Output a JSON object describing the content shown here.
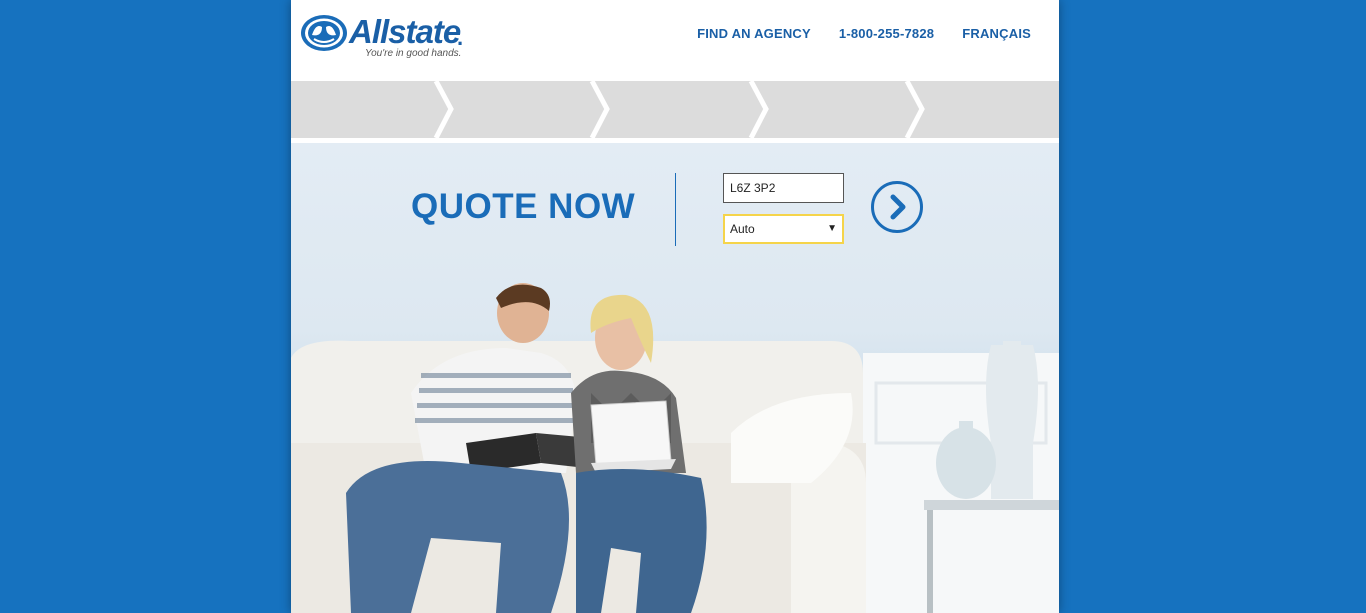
{
  "brand": {
    "name": "Allstate",
    "trademark": ".",
    "tagline": "You're in good hands."
  },
  "nav": {
    "find_agency": "FIND AN AGENCY",
    "phone": "1-800-255-7828",
    "language": "FRANÇAIS"
  },
  "quote": {
    "title": "QUOTE NOW",
    "postal_code_value": "L6Z 3P2",
    "product_selected": "Auto",
    "dropdown_arrow": "▼"
  },
  "icons": {
    "logo": "allstate-hands-icon",
    "submit": "chevron-right-icon"
  },
  "colors": {
    "background": "#1672bf",
    "brand_blue": "#1a6cb8",
    "focus_border": "#f5d44a",
    "step_bar": "#dcdcdc"
  }
}
